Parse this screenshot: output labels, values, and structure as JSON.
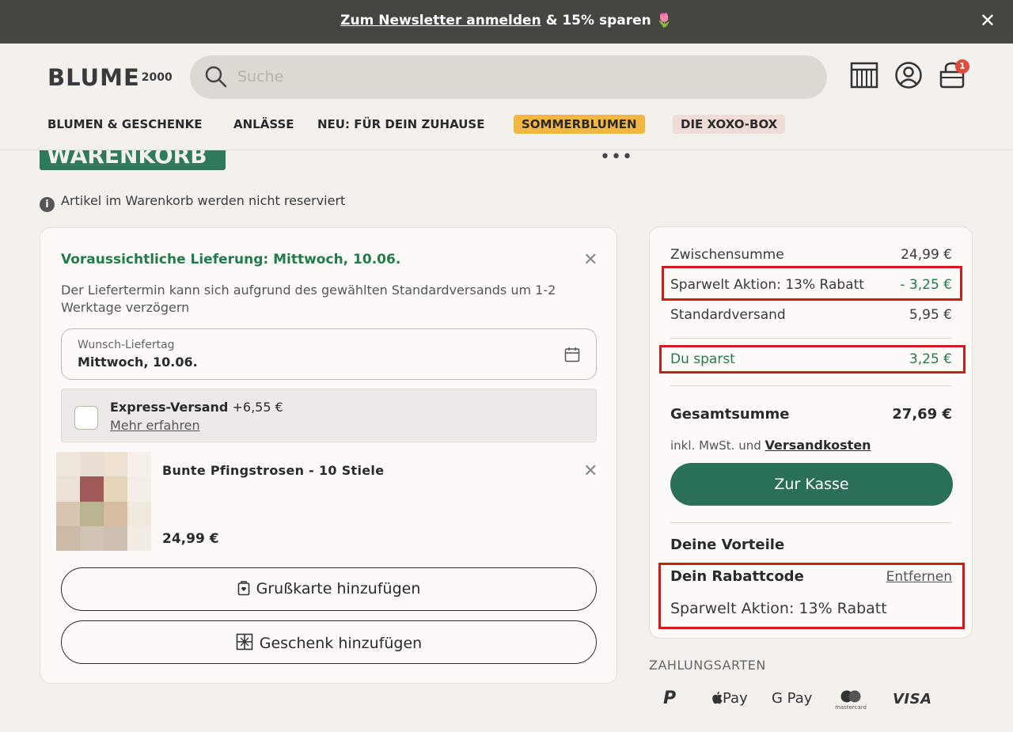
{
  "banner": {
    "link_text": "Zum Newsletter anmelden",
    "rest_text": "& 15% sparen",
    "emoji": "🌷",
    "close_icon": "close-icon"
  },
  "header": {
    "logo": "BLUME",
    "logo_suffix": "2000",
    "search_placeholder": "Suche",
    "icons": [
      "store-icon",
      "account-icon",
      "cart-icon"
    ],
    "cart_count": "1"
  },
  "nav": {
    "items": [
      "BLUMEN & GESCHENKE",
      "ANLÄSSE",
      "NEU: FÜR DEIN ZUHAUSE",
      "SOMMERBLUMEN",
      "DIE XOXO-BOX"
    ]
  },
  "page": {
    "title": "WARENKORB",
    "more": "•••",
    "info": "Artikel im Warenkorb werden nicht reserviert"
  },
  "delivery": {
    "title": "Voraussichtliche Lieferung: Mittwoch, 10.06.",
    "note": "Der Liefertermin kann sich aufgrund des gewählten Standardversands um 1-2 Werktage verzögern",
    "date_label": "Wunsch-Liefertag",
    "date_value": "Mittwoch, 10.06.",
    "express_name": "Express-Versand",
    "express_price": "+6,55 €",
    "express_more": "Mehr erfahren"
  },
  "product": {
    "name": "Bunte Pfingstrosen - 10 Stiele",
    "price": "24,99 €"
  },
  "actions": {
    "greeting_card": "Grußkarte hinzufügen",
    "gift": "Geschenk hinzufügen"
  },
  "summary": {
    "subtotal_label": "Zwischensumme",
    "subtotal_value": "24,99 €",
    "discount_label": "Sparwelt Aktion: 13% Rabatt",
    "discount_value": "- 3,25 €",
    "shipping_label": "Standardversand",
    "shipping_value": "5,95 €",
    "savings_label": "Du sparst",
    "savings_value": "3,25 €",
    "total_label": "Gesamtsumme",
    "total_value": "27,69 €",
    "tax_note": "inkl. MwSt. und",
    "tax_link": "Versandkosten",
    "checkout": "Zur Kasse",
    "benefits_title": "Deine Vorteile",
    "code_title": "Dein Rabattcode",
    "code_remove": "Entfernen",
    "code_value": "Sparwelt Aktion: 13% Rabatt"
  },
  "payment": {
    "label": "ZAHLUNGSARTEN",
    "methods": [
      "P",
      "Pay",
      "G Pay",
      "mastercard",
      "VISA"
    ]
  },
  "colors": {
    "primary_green": "#2a6f57",
    "text_green": "#237a4d",
    "highlight_red": "#d11a1a",
    "banner_bg": "#464641",
    "sommer_bg": "#f4b643"
  }
}
